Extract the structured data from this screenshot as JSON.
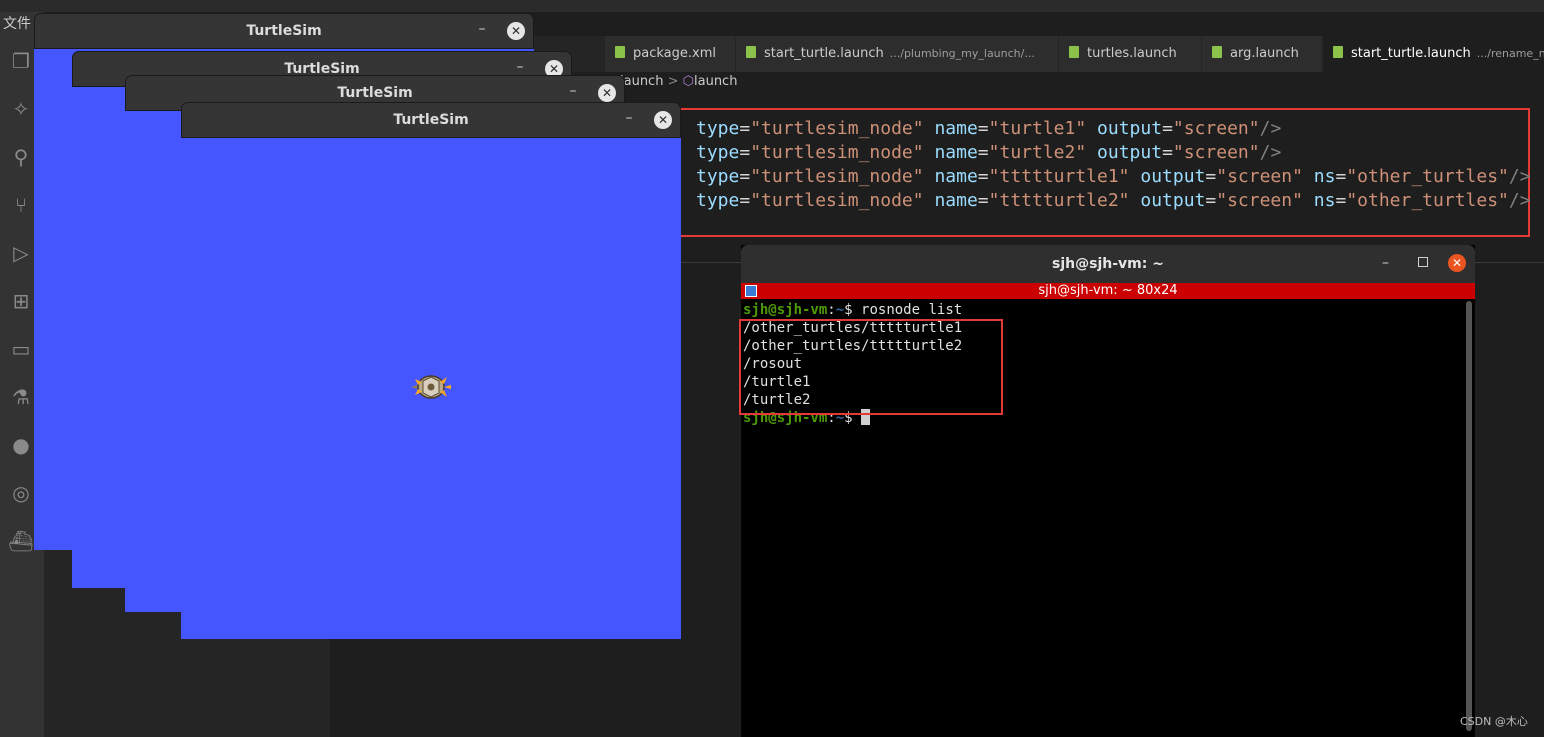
{
  "vscode": {
    "file_menu": "文件",
    "tabs": [
      {
        "label": "package.xml",
        "hint": ""
      },
      {
        "label": "start_turtle.launch",
        "hint": ".../plumbing_my_launch/..."
      },
      {
        "label": "turtles.launch",
        "hint": ""
      },
      {
        "label": "arg.launch",
        "hint": ""
      },
      {
        "label": "start_turtle.launch",
        "hint": ".../rename_no"
      }
    ],
    "breadcrumb": {
      "part1": "launch",
      "separator": ">",
      "part2": "launch"
    },
    "code_lines": [
      {
        "k1": "type",
        "v1": "\"turtlesim_node\"",
        "k2": "name",
        "v2": "\"turtle1\"",
        "k3": "output",
        "v3": "\"screen\"",
        "k4": "",
        "v4": "",
        "end": "/>"
      },
      {
        "k1": "type",
        "v1": "\"turtlesim_node\"",
        "k2": "name",
        "v2": "\"turtle2\"",
        "k3": "output",
        "v3": "\"screen\"",
        "k4": "",
        "v4": "",
        "end": "/>"
      },
      {
        "k1": "type",
        "v1": "\"turtlesim_node\"",
        "k2": "name",
        "v2": "\"ttttturtle1\"",
        "k3": "output",
        "v3": "\"screen\"",
        "k4": "ns",
        "v4": "\"other_turtles\"",
        "end": "/>"
      },
      {
        "k1": "type",
        "v1": "\"turtlesim_node\"",
        "k2": "name",
        "v2": "\"ttttturtle2\"",
        "k3": "output",
        "v3": "\"screen\"",
        "k4": "ns",
        "v4": "\"other_turtles\"",
        "end": "/>"
      }
    ],
    "activity_icons": [
      "files-icon",
      "testing-icon",
      "search-icon",
      "source-control-icon",
      "run-debug-icon",
      "extensions-icon",
      "remote-explorer-icon",
      "flask-icon",
      "github-icon",
      "git-graph-icon",
      "docker-icon"
    ]
  },
  "turtlesim_windows": [
    {
      "title": "TurtleSim",
      "minimize": "–",
      "close": "✕"
    },
    {
      "title": "TurtleSim",
      "minimize": "–",
      "close": "✕"
    },
    {
      "title": "TurtleSim",
      "minimize": "–",
      "close": "✕"
    },
    {
      "title": "TurtleSim",
      "minimize": "–",
      "close": "✕"
    }
  ],
  "turtlesim_bg": "#4556ff",
  "terminal": {
    "title": "sjh@sjh-vm: ~",
    "size_bar": "sjh@sjh-vm: ~ 80x24",
    "prompt_user": "sjh@sjh-vm",
    "prompt_path": "~",
    "command": "rosnode list",
    "output": [
      "/other_turtles/ttttturtle1",
      "/other_turtles/ttttturtle2",
      "/rosout",
      "/turtle1",
      "/turtle2"
    ]
  },
  "watermark": "CSDN @木心",
  "colors": {
    "highlight_box": "#e53935",
    "terminal_bar": "#cc0000",
    "prompt_green": "#4e9a06",
    "prompt_blue": "#3465a4"
  }
}
